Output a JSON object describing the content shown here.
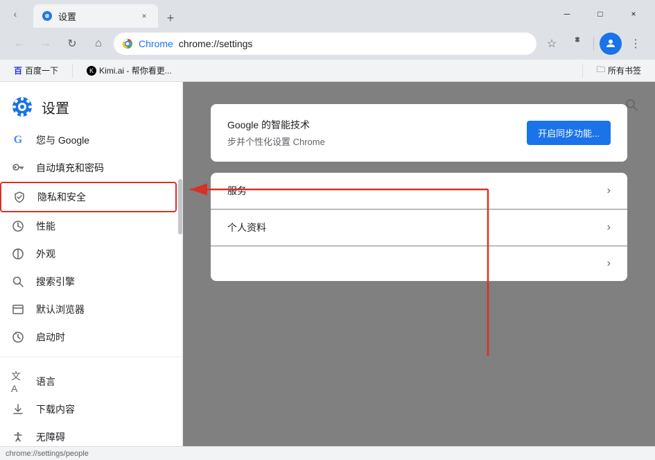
{
  "browser": {
    "tab": {
      "favicon": "⚙",
      "title": "设置",
      "close": "×"
    },
    "new_tab": "+",
    "window_controls": {
      "minimize": "─",
      "maximize": "□",
      "close": "×"
    },
    "address_bar": {
      "back": "←",
      "forward": "→",
      "refresh": "↻",
      "home": "⌂",
      "brand_name": "Chrome",
      "url": "chrome://settings",
      "star": "☆",
      "extensions": "🧩",
      "menu": "⋮"
    },
    "bookmarks": [
      {
        "label": "百度一下"
      },
      {
        "label": "Kimi.ai - 帮你看更..."
      }
    ],
    "bookmarks_right": "所有书签",
    "status_url": "chrome://settings/people"
  },
  "settings": {
    "title": "设置",
    "search_placeholder": "搜索设置",
    "sidebar_items": [
      {
        "id": "google",
        "label": "您与 Google",
        "icon": "G"
      },
      {
        "id": "autofill",
        "label": "自动填充和密码",
        "icon": "🔑"
      },
      {
        "id": "privacy",
        "label": "隐私和安全",
        "icon": "🛡",
        "highlighted": true
      },
      {
        "id": "performance",
        "label": "性能",
        "icon": "⚡"
      },
      {
        "id": "appearance",
        "label": "外观",
        "icon": "🌐"
      },
      {
        "id": "search",
        "label": "搜索引擎",
        "icon": "🔍"
      },
      {
        "id": "browser",
        "label": "默认浏览器",
        "icon": "🗔"
      },
      {
        "id": "startup",
        "label": "启动时",
        "icon": "⏻"
      },
      {
        "id": "language",
        "label": "语言",
        "icon": "文"
      },
      {
        "id": "downloads",
        "label": "下载内容",
        "icon": "⬇"
      },
      {
        "id": "accessibility",
        "label": "无障碍",
        "icon": "♿"
      }
    ],
    "main": {
      "sync_card": {
        "title": "Google 的智能技术",
        "description": "步并个性化设置 Chrome",
        "button": "开启同步功能..."
      },
      "rows": [
        {
          "label": "服务"
        },
        {
          "label": "个人资料"
        },
        {
          "label": ""
        }
      ]
    }
  }
}
